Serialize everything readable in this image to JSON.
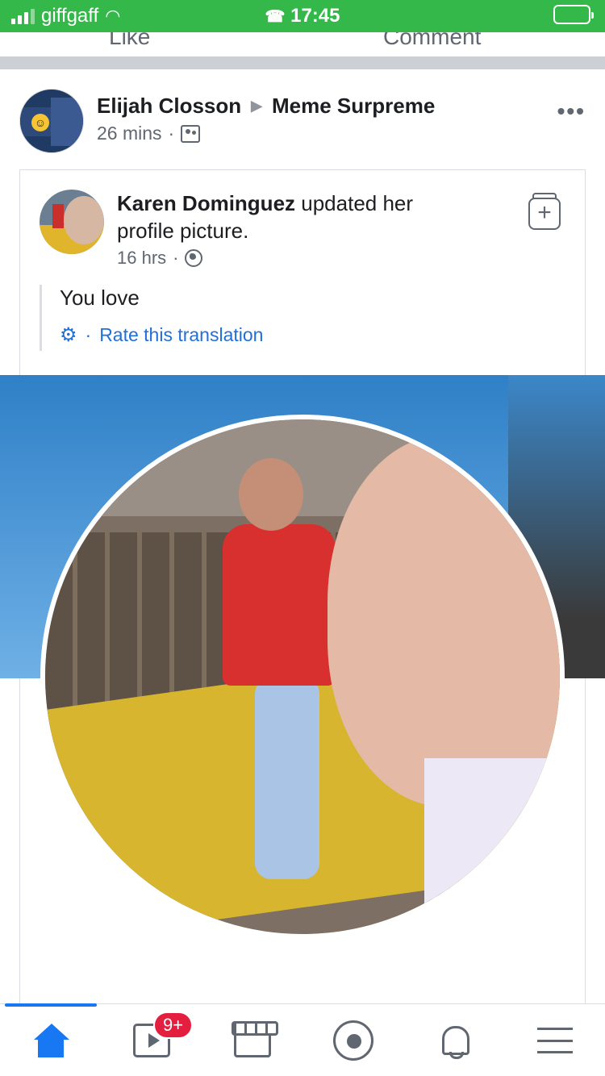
{
  "status_bar": {
    "carrier": "giffgaff",
    "time": "17:45"
  },
  "previous_post": {
    "actions": [
      "Like",
      "Comment"
    ]
  },
  "post": {
    "author": "Elijah Closson",
    "group": "Meme Surpreme",
    "time": "26 mins",
    "more": "•••",
    "shared": {
      "author": "Karen Dominguez",
      "action": "updated her profile picture.",
      "time": "16 hrs",
      "translation_text": "You love",
      "rate_translation": "Rate this translation"
    }
  },
  "nav": {
    "items": [
      "home",
      "watch",
      "marketplace",
      "groups",
      "notifications",
      "menu"
    ],
    "watch_badge": "9+",
    "active": "home"
  },
  "colors": {
    "status_bar": "#34b84a",
    "accent": "#1877f2",
    "link": "#216fdb",
    "badge": "#e41e3f"
  }
}
